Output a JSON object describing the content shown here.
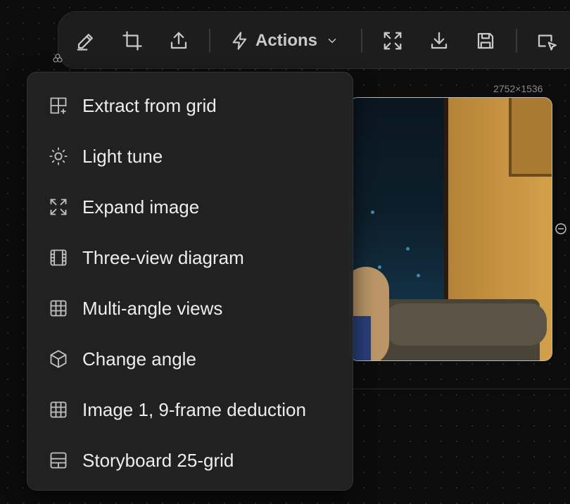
{
  "toolbar": {
    "actions_label": "Actions",
    "buttons": [
      "pencil-icon",
      "crop-icon",
      "upload-icon",
      "expand-icon",
      "download-icon",
      "save-icon",
      "add-to-frame-icon"
    ]
  },
  "image": {
    "dimensions": "2752×1536"
  },
  "menu": {
    "items": [
      {
        "label": "Extract from grid",
        "icon": "grid-plus-icon"
      },
      {
        "label": "Light tune",
        "icon": "sun-icon"
      },
      {
        "label": "Expand image",
        "icon": "expand-arrows-icon"
      },
      {
        "label": "Three-view diagram",
        "icon": "film-icon"
      },
      {
        "label": "Multi-angle views",
        "icon": "grid-icon"
      },
      {
        "label": "Change angle",
        "icon": "cube-icon"
      },
      {
        "label": "Image 1, 9-frame deduction",
        "icon": "grid-icon"
      },
      {
        "label": "Storyboard 25-grid",
        "icon": "layout-icon"
      }
    ]
  },
  "colors": {
    "background": "#0c0c0c",
    "menu_background": "#222222",
    "text": "#ededed"
  }
}
